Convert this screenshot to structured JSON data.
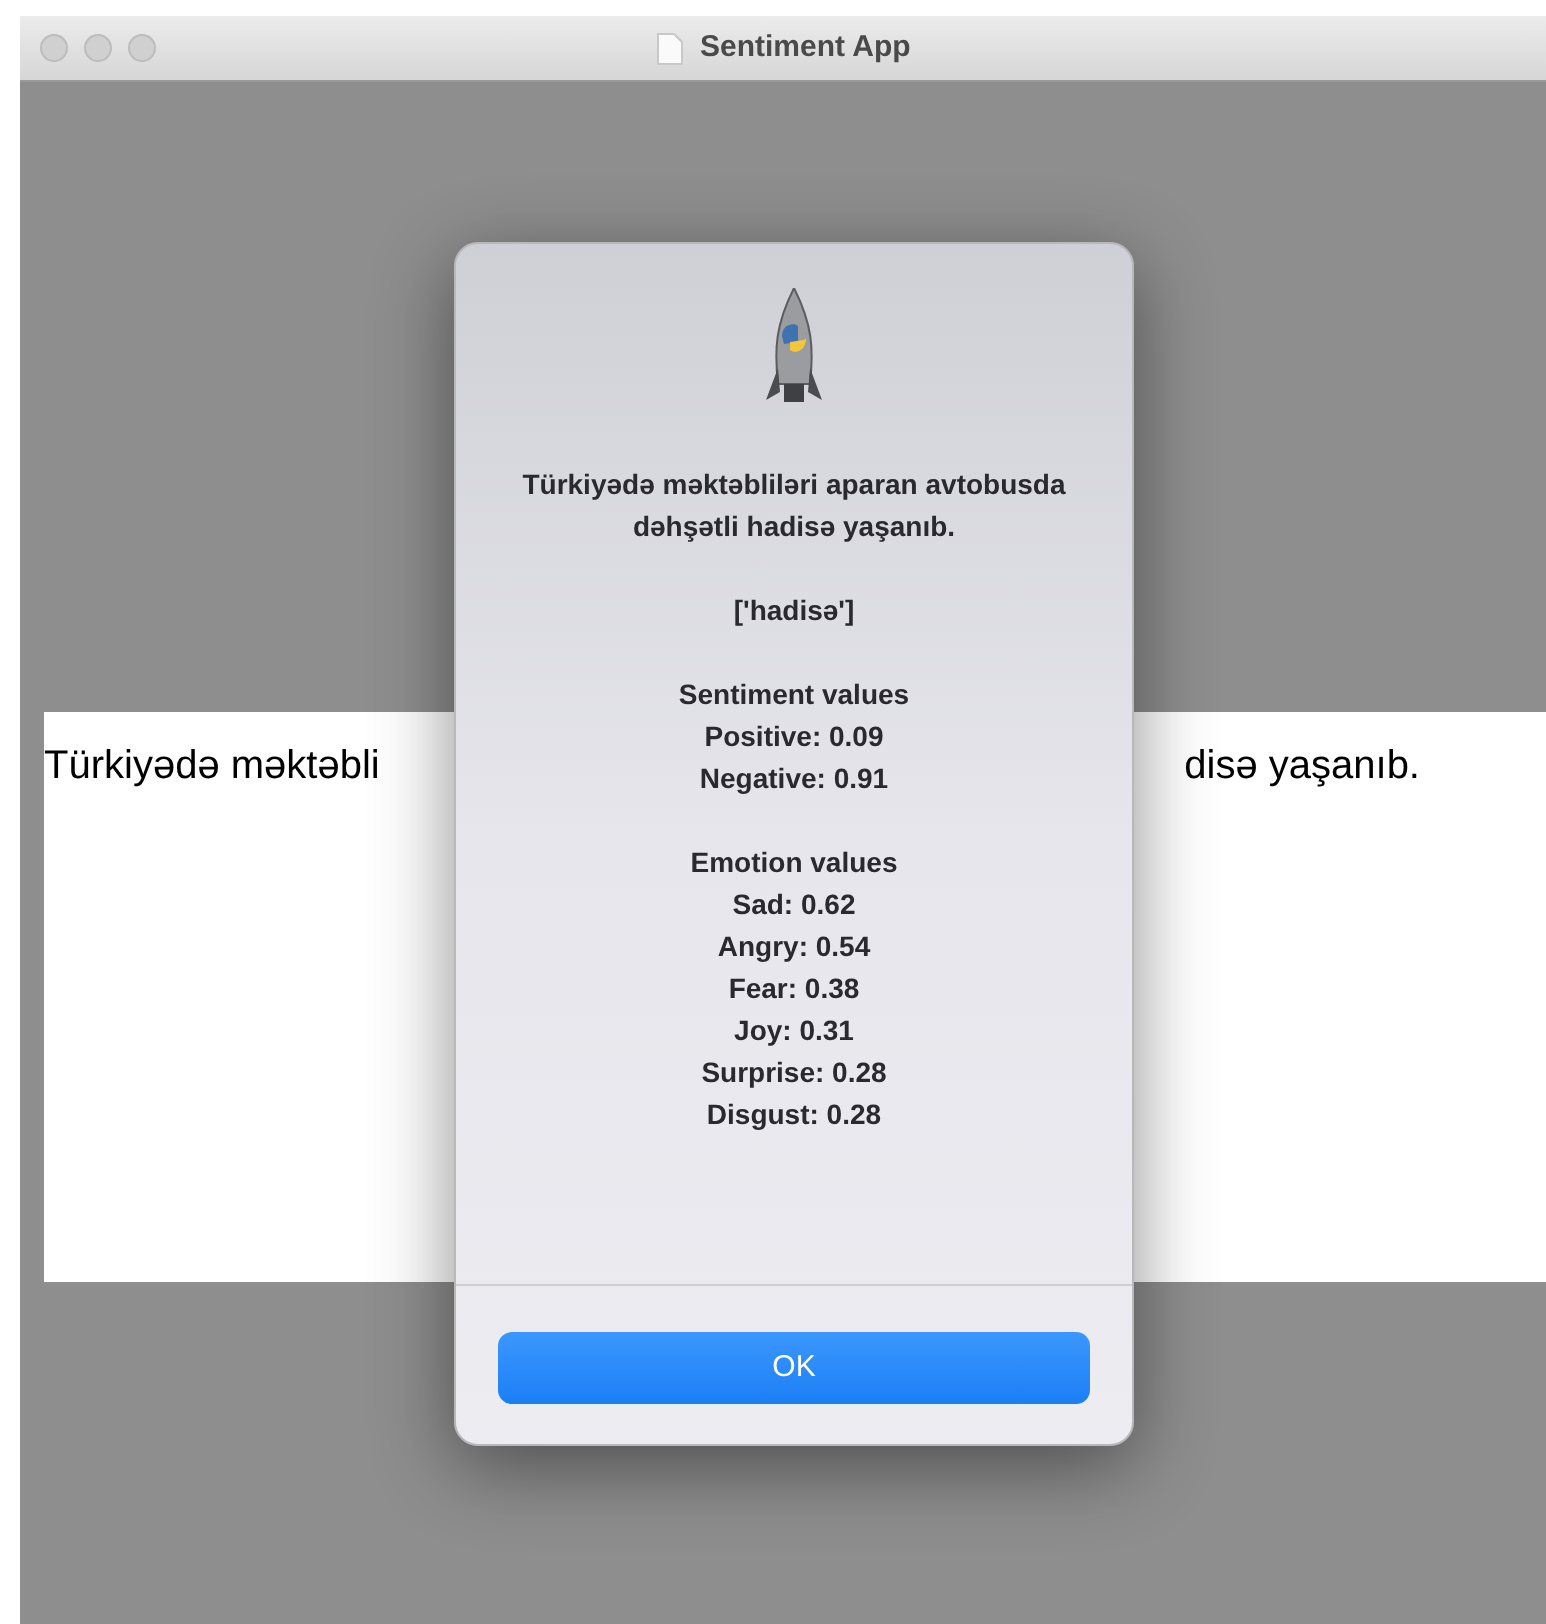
{
  "window": {
    "title": "Sentiment App"
  },
  "text_panel": {
    "left_text": "Türkiyədə məktəbli",
    "right_text": "disə yaşanıb."
  },
  "dialog": {
    "message": "Türkiyədə məktəbliləri aparan avtobusda dəhşətli hadisə yaşanıb.",
    "keywords": "['hadisə']",
    "sections": [
      {
        "heading": "Sentiment values",
        "lines": [
          "Positive: 0.09",
          "Negative: 0.91"
        ]
      },
      {
        "heading": "Emotion values",
        "lines": [
          "Sad: 0.62",
          "Angry: 0.54",
          "Fear: 0.38",
          "Joy: 0.31",
          "Surprise: 0.28",
          "Disgust: 0.28"
        ]
      }
    ],
    "button": "OK"
  }
}
